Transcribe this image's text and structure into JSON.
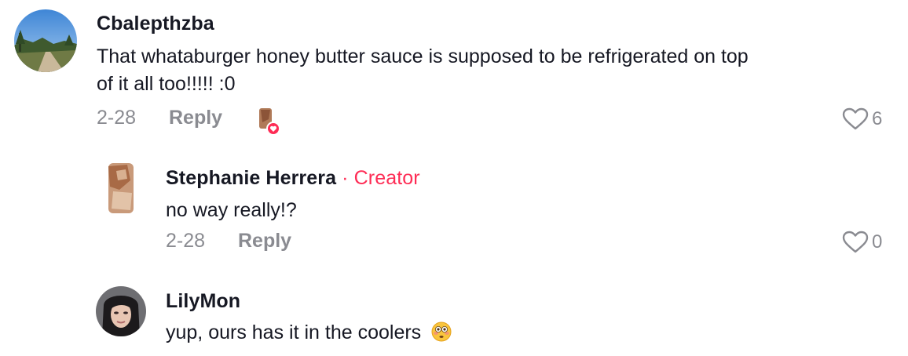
{
  "comments": [
    {
      "username": "Cbalepthzba",
      "text_line1": "That whataburger honey butter sauce is supposed to be refrigerated on top",
      "text_line2": "of it all too!!!!! :0",
      "date": "2-28",
      "reply_label": "Reply",
      "likes": "6",
      "creator_liked": true,
      "avatar_icon": "landscape-road-avatar"
    },
    {
      "username": "Stephanie Herrera",
      "separator": "·",
      "badge": "Creator",
      "text": "no way really!?",
      "date": "2-28",
      "reply_label": "Reply",
      "likes": "0",
      "avatar_icon": "portrait-avatar"
    },
    {
      "username": "LilyMon",
      "text": "yup, ours has it in the coolers",
      "emoji": "flushed-face-emoji",
      "avatar_icon": "portrait-avatar"
    }
  ],
  "colors": {
    "text": "#161823",
    "muted": "#8a8b91",
    "accent": "#fe2c55"
  }
}
